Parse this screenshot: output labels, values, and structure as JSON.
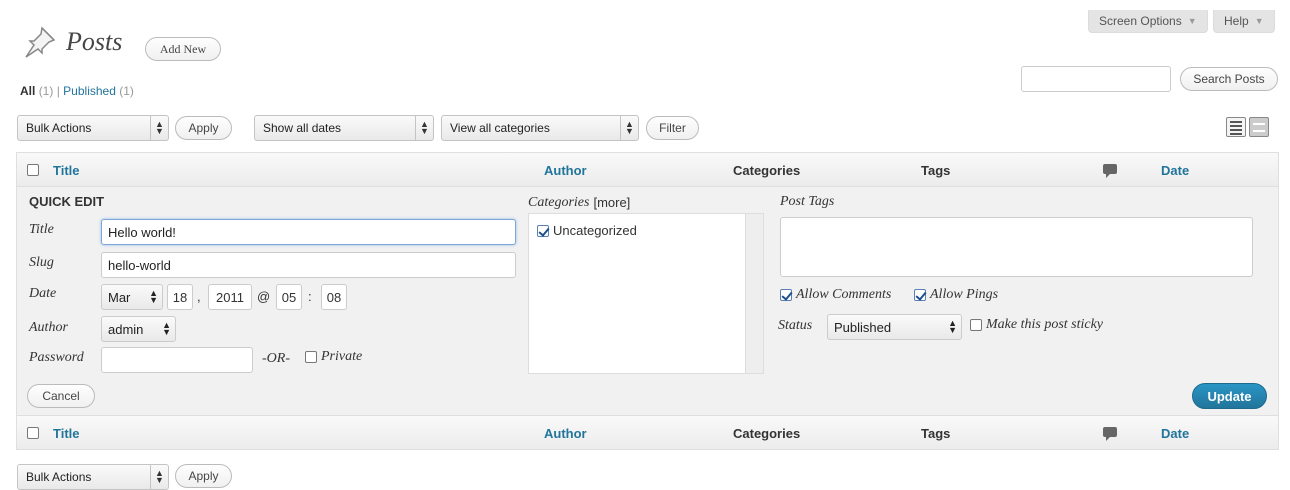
{
  "top_tabs": {
    "screen_options": "Screen Options",
    "help": "Help"
  },
  "header": {
    "title": "Posts",
    "add_new": "Add New"
  },
  "filters_links": {
    "all_label": "All",
    "all_count": "(1)",
    "separator": "|",
    "published_label": "Published",
    "published_count": "(1)"
  },
  "search": {
    "placeholder": "",
    "button": "Search Posts"
  },
  "toolbar_top": {
    "bulk_actions": "Bulk Actions",
    "apply": "Apply",
    "dates": "Show all dates",
    "categories": "View all categories",
    "filter": "Filter"
  },
  "columns": {
    "title": "Title",
    "author": "Author",
    "categories": "Categories",
    "tags": "Tags",
    "date": "Date"
  },
  "quick_edit": {
    "heading": "QUICK EDIT",
    "title_label": "Title",
    "title_value": "Hello world!",
    "slug_label": "Slug",
    "slug_value": "hello-world",
    "date_label": "Date",
    "month": "Mar",
    "day": "18",
    "comma": ",",
    "year": "2011",
    "at": "@",
    "hour": "05",
    "colon": ":",
    "minute": "08",
    "author_label": "Author",
    "author_value": "admin",
    "password_label": "Password",
    "password_value": "",
    "or_label": "-OR-",
    "private_label": "Private",
    "categories_label": "Categories",
    "categories_more": "[more]",
    "category_item": "Uncategorized",
    "post_tags_label": "Post Tags",
    "allow_comments": "Allow Comments",
    "allow_pings": "Allow Pings",
    "status_label": "Status",
    "status_value": "Published",
    "sticky_label": "Make this post sticky",
    "cancel": "Cancel",
    "update": "Update"
  },
  "toolbar_bottom": {
    "bulk_actions": "Bulk Actions",
    "apply": "Apply"
  },
  "colors": {
    "link": "#21759b",
    "update_button": "#21759b",
    "panel_bg": "#f1f1f1"
  },
  "icons": [
    "pushpin-icon",
    "list-view-icon",
    "excerpt-view-icon",
    "comment-bubble-icon",
    "select-arrows-icon"
  ]
}
